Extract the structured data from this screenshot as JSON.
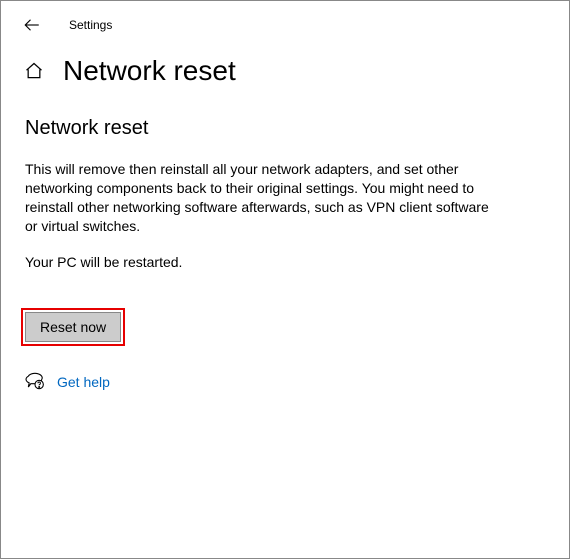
{
  "titlebar": {
    "app_name": "Settings"
  },
  "header": {
    "page_title": "Network reset"
  },
  "main": {
    "section_heading": "Network reset",
    "description": "This will remove then reinstall all your network adapters, and set other networking components back to their original settings. You might need to reinstall other networking software afterwards, such as VPN client software or virtual switches.",
    "restart_note": "Your PC will be restarted.",
    "reset_button_label": "Reset now",
    "help_link_label": "Get help"
  }
}
